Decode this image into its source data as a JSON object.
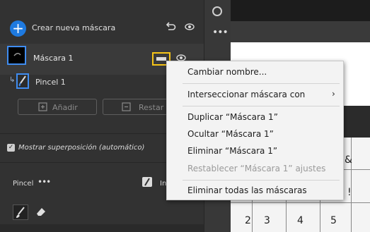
{
  "mask_panel": {
    "create_label": "Crear nueva máscara",
    "mask_name": "Máscara 1",
    "brush_name": "Pincel 1",
    "add_label": "Añadir",
    "reset_label": "Restar"
  },
  "overlay": {
    "label": "Mostrar superposición (automático)",
    "checked": true
  },
  "brush_section": {
    "label": "Pincel",
    "more": "•••",
    "truncated_label": "In"
  },
  "toolstrip": {
    "more": "•••"
  },
  "canvas": {
    "glyph_amp": "&",
    "glyph_dot": "!",
    "numbers": [
      "2",
      "3",
      "4",
      "5"
    ]
  },
  "context_menu": {
    "items": [
      {
        "label": "Cambiar nombre...",
        "enabled": true
      },
      {
        "label": "Interseccionar máscara con",
        "enabled": true,
        "submenu": true
      },
      {
        "label": "Duplicar “Máscara 1”",
        "enabled": true
      },
      {
        "label": "Ocultar “Máscara 1”",
        "enabled": true
      },
      {
        "label": "Eliminar “Máscara 1”",
        "enabled": true
      },
      {
        "label": "Restablecer “Máscara 1” ajustes",
        "enabled": false
      },
      {
        "label": "Eliminar todas las máscaras",
        "enabled": true
      }
    ],
    "submenu_chevron": "›"
  },
  "colors": {
    "accent": "#1e7ae0",
    "highlight": "#f7c518",
    "panel_bg": "#323232"
  }
}
